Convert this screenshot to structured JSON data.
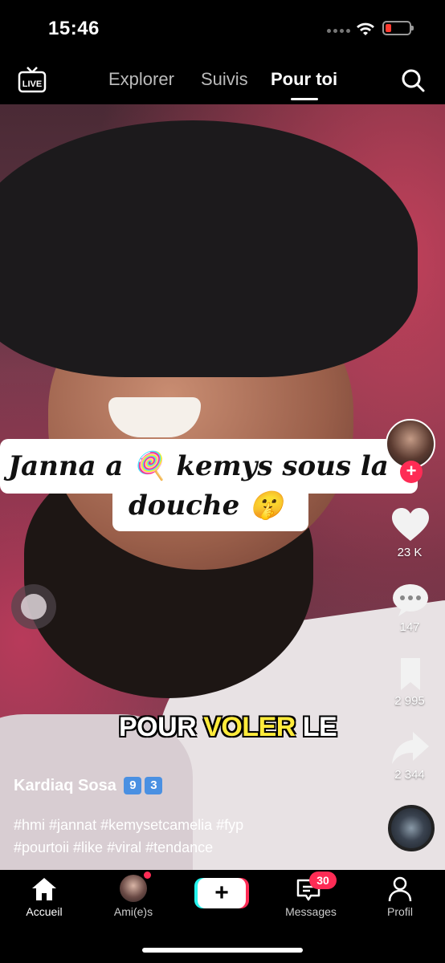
{
  "status_bar": {
    "time": "15:46",
    "battery_color": "#ff3b30"
  },
  "top_nav": {
    "live_label": "LIVE",
    "tabs": [
      {
        "label": "Explorer",
        "active": false
      },
      {
        "label": "Suivis",
        "active": false
      },
      {
        "label": "Pour toi",
        "active": true
      }
    ],
    "search_icon": "search-icon"
  },
  "video": {
    "caption_line1": "Janna a 🍭 kemys sous la",
    "caption_line2": "douche 🤫",
    "subtitle_white1": "POUR ",
    "subtitle_yellow": "VOLER",
    "subtitle_white2": " LE"
  },
  "side_actions": {
    "likes": "23 K",
    "comments": "147",
    "saves": "2 995",
    "shares": "2 344"
  },
  "post": {
    "username": "Kardiaq Sosa",
    "badge1": "9",
    "badge2": "3",
    "hashtags_line1": "#hmi #jannat #kemysetcamelia #fyp",
    "hashtags_line2": "#pourtoii #like #viral #tendance"
  },
  "bottom_nav": {
    "home": "Accueil",
    "friends": "Ami(e)s",
    "create": "+",
    "messages": "Messages",
    "messages_badge": "30",
    "profile": "Profil"
  },
  "colors": {
    "accent_red": "#fe2c55",
    "accent_cyan": "#25f4ee",
    "subtitle_yellow": "#ffeb3b"
  }
}
